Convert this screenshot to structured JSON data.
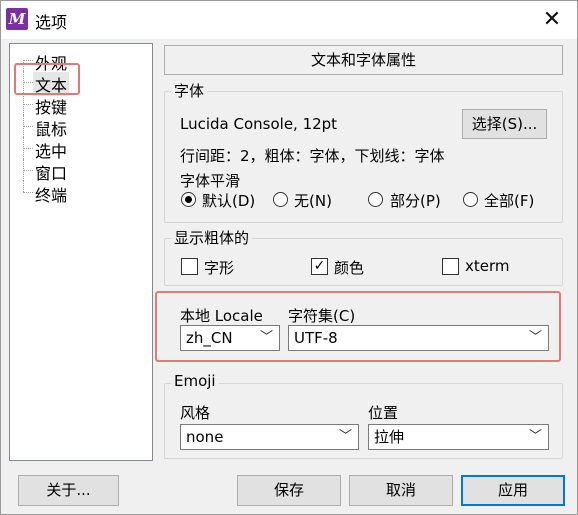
{
  "window": {
    "title": "选项",
    "close_icon": "close-icon",
    "app_icon_letter": "M"
  },
  "tree": {
    "items": [
      {
        "label": "外观"
      },
      {
        "label": "文本",
        "selected": true
      },
      {
        "label": "按键"
      },
      {
        "label": "鼠标"
      },
      {
        "label": "选中"
      },
      {
        "label": "窗口"
      },
      {
        "label": "终端"
      }
    ]
  },
  "pane": {
    "header": "文本和字体属性",
    "font_group": {
      "title": "字体",
      "font_name": "Lucida Console, 12pt",
      "choose_button": "选择(S)...",
      "details": "行间距：2，粗体：字体，下划线：字体",
      "smoothing_label": "字体平滑",
      "smoothing_options": [
        {
          "label": "默认(D)",
          "checked": true
        },
        {
          "label": "无(N)",
          "checked": false
        },
        {
          "label": "部分(P)",
          "checked": false
        },
        {
          "label": "全部(F)",
          "checked": false
        }
      ]
    },
    "bold_group": {
      "title": "显示粗体的",
      "options": [
        {
          "label": "字形",
          "checked": false
        },
        {
          "label": "颜色",
          "checked": true
        },
        {
          "label": "xterm",
          "checked": false
        }
      ]
    },
    "locale_group": {
      "locale_label": "本地 Locale",
      "locale_value": "zh_CN",
      "charset_label": "字符集(C)",
      "charset_value": "UTF-8"
    },
    "emoji_group": {
      "title": "Emoji",
      "style_label": "风格",
      "style_value": "none",
      "position_label": "位置",
      "position_value": "拉伸"
    }
  },
  "footer": {
    "about_button": "关于...",
    "save_button": "保存",
    "cancel_button": "取消",
    "apply_button": "应用"
  },
  "colors": {
    "highlight_box": "#e07a7a",
    "focus_blue": "#0078d7"
  }
}
